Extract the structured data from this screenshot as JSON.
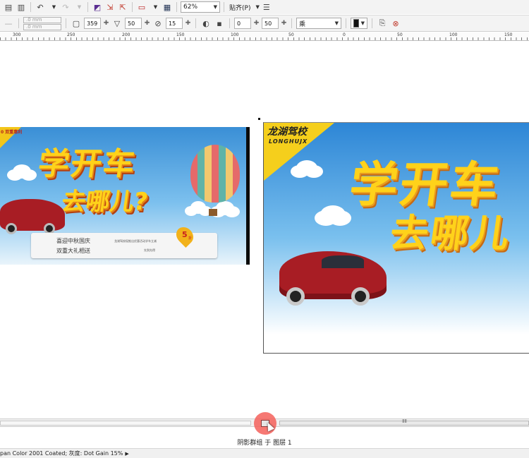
{
  "toolbar": {
    "zoom": "62%",
    "snap_label": "贴齐(P)",
    "width_value": "359",
    "height_value": "50",
    "rotation_value": "15",
    "offset_x": "0",
    "offset_y": "50",
    "nudge_x": ".0 mm",
    "nudge_y": ".0 mm",
    "shadow_preset": "乘"
  },
  "ruler": {
    "labels": [
      "300",
      "250",
      "200",
      "150",
      "100",
      "50",
      "0",
      "50",
      "100",
      "150"
    ]
  },
  "left_banner": {
    "corner_text": "0 双重惠利",
    "headline_line1": "学开车",
    "headline_line2": "去哪儿?",
    "ribbon_line1": "喜迎中秋国庆",
    "ribbon_line2": "双重大礼相送",
    "ribbon_small1": "龙湖驾校现推出优惠活动学车立减",
    "ribbon_small2": "先到先得",
    "discount": "5",
    "discount_unit": "折"
  },
  "right_banner": {
    "brand_cn": "龙湖驾校",
    "brand_en": "LONGHUJX",
    "headline_line1": "学开车",
    "headline_line2": "去哪儿"
  },
  "status": {
    "object_info": "阴影群组 于 图层 1",
    "color_profile": "pan Color 2001 Coated; 灰度: Dot Gain 15%",
    "scroll_grip": "ⅡⅡ"
  },
  "colors": {
    "accent_yellow": "#ffd21a",
    "car_red": "#a81d24",
    "sky_blue": "#2d86d6",
    "nav_button": "#f5605a"
  }
}
